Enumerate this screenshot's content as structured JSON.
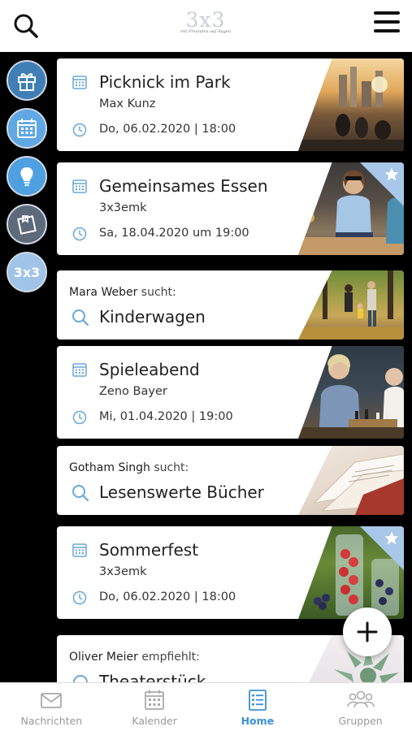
{
  "header": {
    "logo_main": "3x3",
    "logo_sub": "mit Freunden auf Augen"
  },
  "side_nav": [
    {
      "name": "gift",
      "icon": "gift-icon"
    },
    {
      "name": "calendar",
      "icon": "calendar-icon"
    },
    {
      "name": "idea",
      "icon": "lightbulb-icon"
    },
    {
      "name": "notes",
      "icon": "note-icon"
    },
    {
      "name": "3x3",
      "label": "3x3"
    }
  ],
  "feed": {
    "events": [
      {
        "title": "Picknick im Park",
        "organizer": "Max Kunz",
        "date": "Do, 06.02.2020 | 18:00",
        "starred": false
      },
      {
        "title": "Gemeinsames Essen",
        "organizer": "3x3emk",
        "date": "Sa, 18.04.2020 um 19:00",
        "starred": true
      },
      {
        "title": "Spieleabend",
        "organizer": "Zeno Bayer",
        "date": "Mi, 01.04.2020 | 19:00",
        "starred": false
      },
      {
        "title": "Sommerfest",
        "organizer": "3x3emk",
        "date": "Do, 06.02.2020 | 18:00",
        "starred": true
      }
    ],
    "requests": [
      {
        "person": "Mara Weber",
        "verb": "sucht:",
        "item": "Kinderwagen"
      },
      {
        "person": "Gotham Singh",
        "verb": "sucht:",
        "item": "Lesenswerte Bücher"
      },
      {
        "person": "Oliver Meier",
        "verb": "empfiehlt:",
        "item": "Theaterstück"
      }
    ]
  },
  "tabbar": [
    {
      "label": "Nachrichten",
      "active": false
    },
    {
      "label": "Kalender",
      "active": false
    },
    {
      "label": "Home",
      "active": true
    },
    {
      "label": "Gruppen",
      "active": false
    }
  ],
  "colors": {
    "accent": "#3a8fd8",
    "icon_blue": "#6aa7d8",
    "ribbon": "#a9c7e8",
    "side_button_bg": "#3f7fb5"
  }
}
